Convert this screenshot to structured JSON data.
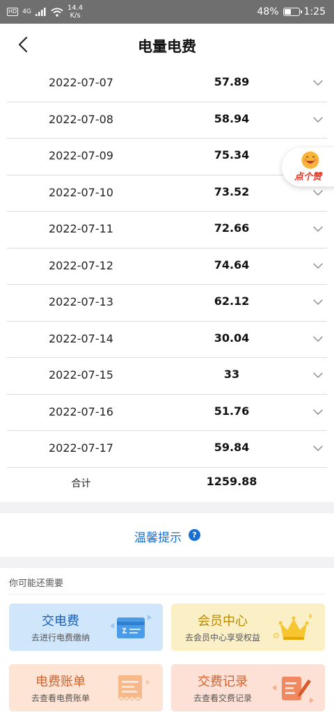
{
  "status_bar": {
    "hd": "HD",
    "network": "4G",
    "speed_value": "14.4",
    "speed_unit": "K/s",
    "battery": "48%",
    "battery_level": 0.48,
    "time": "1:25"
  },
  "header": {
    "title": "电量电费",
    "back_icon": "chevron-left-icon"
  },
  "table": {
    "rows": [
      {
        "date": "2022-07-07",
        "value": "57.89"
      },
      {
        "date": "2022-07-08",
        "value": "58.94"
      },
      {
        "date": "2022-07-09",
        "value": "75.34"
      },
      {
        "date": "2022-07-10",
        "value": "73.52"
      },
      {
        "date": "2022-07-11",
        "value": "72.66"
      },
      {
        "date": "2022-07-12",
        "value": "74.64"
      },
      {
        "date": "2022-07-13",
        "value": "62.12"
      },
      {
        "date": "2022-07-14",
        "value": "30.04"
      },
      {
        "date": "2022-07-15",
        "value": "33"
      },
      {
        "date": "2022-07-16",
        "value": "51.76"
      },
      {
        "date": "2022-07-17",
        "value": "59.84"
      }
    ],
    "total_label": "合计",
    "total_value": "1259.88"
  },
  "like_badge": {
    "label": "点个赞",
    "icon": "smiley-face-icon"
  },
  "tip": {
    "label": "温馨提示",
    "icon": "?"
  },
  "recommend": {
    "title": "你可能还需要",
    "cards": [
      {
        "title": "交电费",
        "subtitle": "去进行电费缴纳",
        "icon": "card-payment-icon"
      },
      {
        "title": "会员中心",
        "subtitle": "去会员中心享受权益",
        "icon": "crown-icon"
      },
      {
        "title": "电费账单",
        "subtitle": "去查看电费账单",
        "icon": "receipt-icon"
      },
      {
        "title": "交费记录",
        "subtitle": "去查看交费记录",
        "icon": "record-pen-icon"
      }
    ]
  },
  "colors": {
    "accent_blue": "#1a6fd1",
    "like_red": "#e8321e",
    "status_bar": "#6f6f70"
  }
}
